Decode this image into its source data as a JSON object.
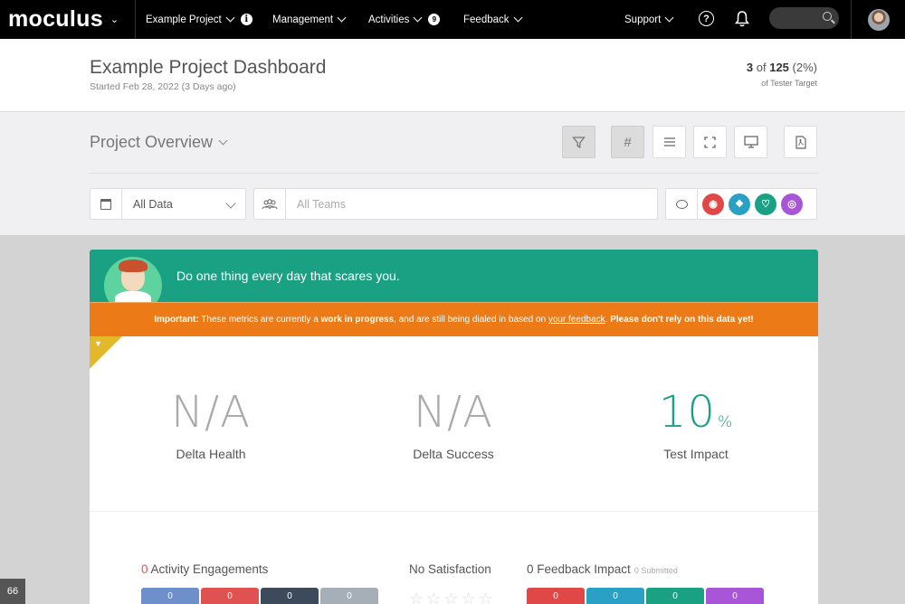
{
  "nav": {
    "brand": "moculus",
    "items": [
      {
        "label": "Example Project"
      },
      {
        "label": "Management"
      },
      {
        "label": "Activities",
        "badge": "9"
      },
      {
        "label": "Feedback"
      }
    ],
    "support": "Support"
  },
  "header": {
    "title": "Example Project Dashboard",
    "subtitle": "Started Feb 28, 2022 (3 Days ago)",
    "tester_count": "3",
    "tester_of": "of",
    "tester_total": "125",
    "tester_pct": "(2%)",
    "tester_sub": "of Tester Target"
  },
  "overview": {
    "title": "Project Overview",
    "date_filter": "All Data",
    "teams_placeholder": "All Teams",
    "category_colors": [
      "#e04848",
      "#2aa0c4",
      "#1aa083",
      "#a855d8"
    ]
  },
  "card": {
    "quote": "Do one thing every day that scares you.",
    "warning": {
      "important": "Important:",
      "part1": " These metrics are currently a ",
      "wip": "work in progress",
      "part2": ", and are still being dialed in based on ",
      "link": "your feedback",
      "part3": ". ",
      "strong_end": "Please don't rely on this data yet!"
    },
    "metrics": [
      {
        "value": "N/A",
        "label": "Delta Health"
      },
      {
        "value": "N/A",
        "label": "Delta Success"
      },
      {
        "value": "10",
        "unit": "%",
        "label": "Test Impact"
      }
    ],
    "activity": {
      "count": "0",
      "label": "Activity Engagements",
      "pills": [
        "0",
        "0",
        "0",
        "0"
      ]
    },
    "satisfaction": {
      "label": "No Satisfaction"
    },
    "feedback": {
      "label": "0 Feedback Impact",
      "submitted": "0 Submitted",
      "pills": [
        "0",
        "0",
        "0",
        "0"
      ]
    }
  },
  "corner_badge": "66"
}
